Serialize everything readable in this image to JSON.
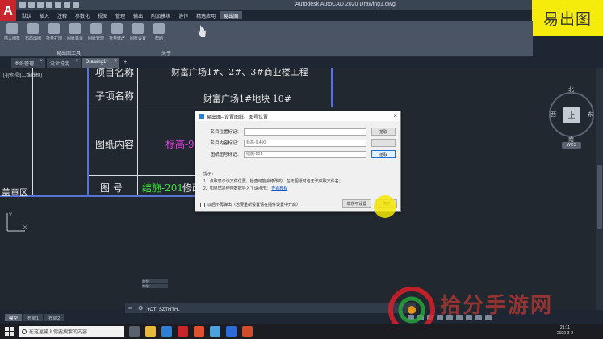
{
  "app": {
    "logo_letter": "A",
    "title": "Autodesk AutoCAD 2020    Drawing1.dwg"
  },
  "brand_box": "易出图",
  "ribbon_tabs": [
    "默认",
    "插入",
    "注释",
    "参数化",
    "视图",
    "管理",
    "输出",
    "附加模块",
    "协作",
    "精选应用",
    "易出图"
  ],
  "ribbon_active_tab": "易出图",
  "ribbon_tools": [
    "插入图框",
    "布局出图",
    "批量打印",
    "图纸目录",
    "图纸管理",
    "批量修改",
    "图框设置",
    "帮助"
  ],
  "ribbon_panels": [
    "易出图工具",
    "关于"
  ],
  "doc_tabs": [
    {
      "label": "图纸管理",
      "active": false
    },
    {
      "label": "设计说明",
      "active": false
    },
    {
      "label": "Drawing1*",
      "active": true
    }
  ],
  "viewport_label": "[-][俯视][二维线框]",
  "title_block": {
    "row1_label": "项目名称",
    "row1_value": "财富广场1#、2#、3#商业楼工程",
    "row2_label": "子项名称",
    "row2_value": "财富广场1#地块  10#",
    "row3_label": "图纸内容",
    "row3_value": "标高-9.",
    "row4_label": "图  号",
    "row4_value": "结施-201",
    "row4_extra": "修改",
    "left_fragment": "盖章区"
  },
  "navcube": {
    "north": "北",
    "south": "南",
    "west": "西",
    "east": "东",
    "face": "上",
    "wcs": "WCS"
  },
  "dialog": {
    "title": "易出图--设置图纸、图号位置",
    "rows": [
      {
        "label": "名目位置标记：",
        "value": "",
        "button": "拾取"
      },
      {
        "label": "名目内容标记：",
        "value": "标高-9.400"
      },
      {
        "label": "图纸图号标记：",
        "value": "结施-201",
        "button": "拾取"
      }
    ],
    "tips_title": "提示：",
    "tip1": "1、点取表示该文件位置，检查可能会修改的，在无图纸时也无法获取文件名；",
    "tip2": "2、如果您是使用数据导入了请点击：",
    "tip2_link": "查看教程",
    "checkbox_label": "以后不再弹出（若要重新设置请在插件设置中开启）",
    "skip_button": "本次不设置",
    "ok_button": "确定"
  },
  "command": {
    "history": [
      "命令：",
      "命令："
    ],
    "prompt": "YCT_SZTHTH："
  },
  "layout_tabs": [
    {
      "label": "模型",
      "active": true
    },
    {
      "label": "布局1",
      "active": false
    },
    {
      "label": "布局2",
      "active": false
    }
  ],
  "taskbar": {
    "search_placeholder": "在这里输入你要搜索的内容",
    "time": "21:11",
    "date": "2020-3-2"
  },
  "watermark_text": "拾分手游网",
  "colors": {
    "title_block_blue": "#5a71d6",
    "magenta_text": "#ea3fe6",
    "green_text": "#3fe23b",
    "brand_yellow": "#f5ec0b",
    "highlight_yellow": "#f5e800"
  }
}
